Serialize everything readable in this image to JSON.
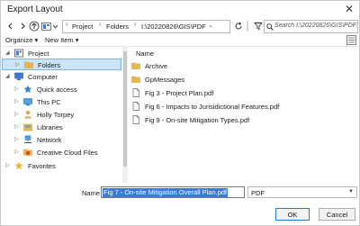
{
  "window": {
    "title": "Export Layout",
    "close_glyph": "✕"
  },
  "toolbar": {
    "breadcrumbs": [
      "Project",
      "Folders",
      "I:\\20220826\\GIS\\PDF"
    ],
    "search_placeholder": "Search I:\\20220826\\GIS\\PDF"
  },
  "commands": {
    "organize": "Organize ▾",
    "new_item": "New Item ▾"
  },
  "tree": [
    {
      "label": "Project",
      "icon": "project-icon",
      "expanded": true
    },
    {
      "label": "Folders",
      "icon": "folder-icon",
      "selected": true
    },
    {
      "label": "Computer",
      "icon": "computer-icon",
      "expanded": true
    },
    {
      "label": "Quick access",
      "icon": "star-icon"
    },
    {
      "label": "This PC",
      "icon": "pc-icon"
    },
    {
      "label": "Holly Torpey",
      "icon": "user-icon"
    },
    {
      "label": "Libraries",
      "icon": "library-icon"
    },
    {
      "label": "Network",
      "icon": "network-icon"
    },
    {
      "label": "Creative Cloud Files",
      "icon": "cloud-icon"
    },
    {
      "label": "Favorites",
      "icon": "favorites-icon"
    }
  ],
  "list": {
    "header": "Name",
    "items": [
      {
        "label": "Archive",
        "icon": "folder-icon"
      },
      {
        "label": "GpMessages",
        "icon": "folder-icon"
      },
      {
        "label": "Fig 3 - Project Plan.pdf",
        "icon": "pdf-file-icon"
      },
      {
        "label": "Fig 6 - Impacts to Jurisidictional Features.pdf",
        "icon": "pdf-file-icon"
      },
      {
        "label": "Fig 9 - On-site Mitigation Types.pdf",
        "icon": "pdf-file-icon"
      }
    ]
  },
  "footer": {
    "name_label": "Name",
    "name_value": "Fig 7 - On-site Mitigation Overall Plan.pdf",
    "type_value": "PDF",
    "ok_label": "OK",
    "cancel_label": "Cancel"
  },
  "colors": {
    "accent": "#3a7bd5",
    "selection": "#cce4f7",
    "folder": "#e8b84a"
  }
}
